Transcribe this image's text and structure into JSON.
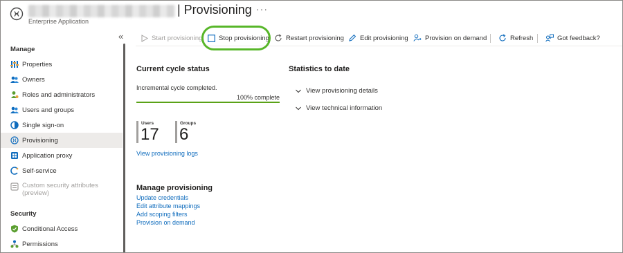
{
  "header": {
    "title": "| Provisioning",
    "subtitle": "Enterprise Application",
    "more": "···"
  },
  "sidebar": {
    "collapse_glyph": "«",
    "sections": [
      {
        "title": "Manage",
        "items": [
          {
            "label": "Properties",
            "icon": "properties-icon",
            "active": false,
            "disabled": false
          },
          {
            "label": "Owners",
            "icon": "owners-icon",
            "active": false,
            "disabled": false
          },
          {
            "label": "Roles and administrators",
            "icon": "roles-icon",
            "active": false,
            "disabled": false
          },
          {
            "label": "Users and groups",
            "icon": "users-groups-icon",
            "active": false,
            "disabled": false
          },
          {
            "label": "Single sign-on",
            "icon": "sso-icon",
            "active": false,
            "disabled": false
          },
          {
            "label": "Provisioning",
            "icon": "provisioning-icon",
            "active": true,
            "disabled": false
          },
          {
            "label": "Application proxy",
            "icon": "app-proxy-icon",
            "active": false,
            "disabled": false
          },
          {
            "label": "Self-service",
            "icon": "self-service-icon",
            "active": false,
            "disabled": false
          },
          {
            "label": "Custom security attributes",
            "label2": "(preview)",
            "icon": "custom-attributes-icon",
            "active": false,
            "disabled": true
          }
        ]
      },
      {
        "title": "Security",
        "items": [
          {
            "label": "Conditional Access",
            "icon": "conditional-access-icon",
            "active": false,
            "disabled": false
          },
          {
            "label": "Permissions",
            "icon": "permissions-icon",
            "active": false,
            "disabled": false
          }
        ]
      }
    ]
  },
  "toolbar": {
    "start": "Start provisioning",
    "stop": "Stop provisioning",
    "restart": "Restart provisioning",
    "edit": "Edit provisioning",
    "on_demand": "Provision on demand",
    "refresh": "Refresh",
    "feedback": "Got feedback?"
  },
  "cycle": {
    "heading": "Current cycle status",
    "status": "Incremental cycle completed.",
    "progress": 1.0,
    "progress_text": "100% complete",
    "users_label": "Users",
    "users_value": "17",
    "groups_label": "Groups",
    "groups_value": "6",
    "logs_link": "View provisioning logs"
  },
  "stats": {
    "heading": "Statistics to date",
    "details": "View provisioning details",
    "technical": "View technical information"
  },
  "manage": {
    "heading": "Manage provisioning",
    "links": [
      "Update credentials",
      "Edit attribute mappings",
      "Add scoping filters",
      "Provision on demand"
    ]
  },
  "colors": {
    "accent": "#0f6cbd",
    "highlight": "#57b629",
    "progress": "#5aa217"
  }
}
